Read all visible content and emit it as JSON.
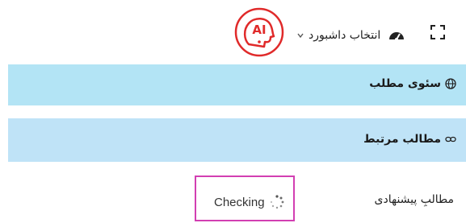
{
  "toolbar": {
    "dashboard_select_label": "انتخاب داشبورد",
    "fullscreen_icon": "expand-corners-icon",
    "gauge_icon": "speedometer-icon",
    "logo_text": "AI"
  },
  "panels": [
    {
      "title": "سئوی مطلب",
      "icon": "globe-icon"
    },
    {
      "title": "مطالب مرتبط",
      "icon": "link-icon"
    }
  ],
  "suggested": {
    "label": "مطالبِ پیشنهادی",
    "status": "Checking",
    "status_icon": "loading-spinner-icon"
  },
  "colors": {
    "panel_bg": "#b3e4f5",
    "logo_red": "#e02a2a",
    "highlight_border": "#d23fb2"
  }
}
